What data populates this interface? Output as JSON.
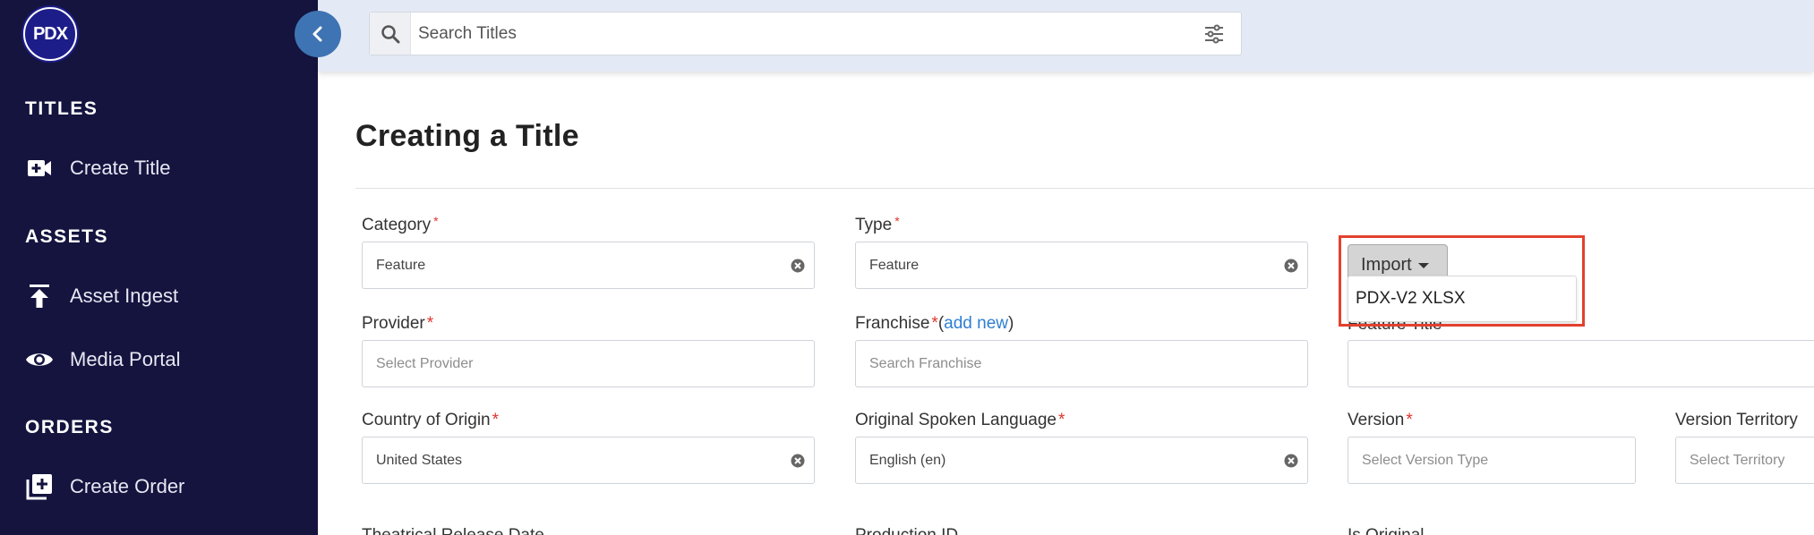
{
  "sidebar": {
    "logo_text": "PDX",
    "sections": [
      {
        "title": "TITLES",
        "items": [
          {
            "label": "Create Title",
            "icon": "video-plus-icon"
          }
        ]
      },
      {
        "title": "ASSETS",
        "items": [
          {
            "label": "Asset Ingest",
            "icon": "upload-icon"
          },
          {
            "label": "Media Portal",
            "icon": "eye-icon"
          }
        ]
      },
      {
        "title": "ORDERS",
        "items": [
          {
            "label": "Create Order",
            "icon": "add-box-icon"
          }
        ]
      }
    ]
  },
  "search": {
    "placeholder": "Search Titles"
  },
  "page": {
    "title": "Creating a Title"
  },
  "form": {
    "category": {
      "label": "Category",
      "value": "Feature"
    },
    "type": {
      "label": "Type",
      "value": "Feature"
    },
    "provider": {
      "label": "Provider",
      "placeholder": "Select Provider"
    },
    "franchise": {
      "label": "Franchise",
      "add_new": "add new",
      "placeholder": "Search Franchise"
    },
    "feature_title": {
      "label": "Feature Title"
    },
    "country": {
      "label": "Country of Origin",
      "value": "United States"
    },
    "language": {
      "label": "Original Spoken Language",
      "value": "English (en)"
    },
    "version": {
      "label": "Version",
      "placeholder": "Select Version Type"
    },
    "version_territory": {
      "label": "Version Territory",
      "placeholder": "Select Territory"
    },
    "theatrical": {
      "label": "Theatrical Release Date"
    },
    "production_id": {
      "label": "Production ID"
    },
    "is_original": {
      "label": "Is Original"
    }
  },
  "import": {
    "label": "Import",
    "options": [
      "PDX-V2 XLSX"
    ]
  },
  "colors": {
    "sidebar": "#14143f",
    "accent": "#3e74b3",
    "highlight": "#e2412f",
    "required": "#e0342c",
    "link": "#2f7fd1"
  }
}
